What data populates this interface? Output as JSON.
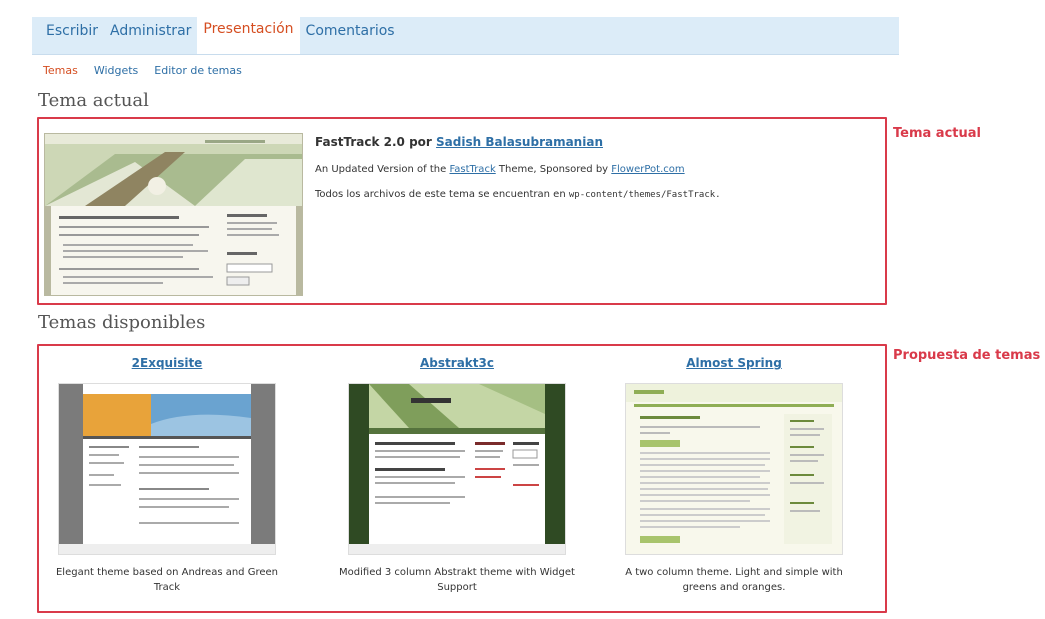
{
  "main_tabs": [
    {
      "label": "Escribir",
      "active": false
    },
    {
      "label": "Administrar",
      "active": false
    },
    {
      "label": "Presentación",
      "active": true
    },
    {
      "label": "Comentarios",
      "active": false
    }
  ],
  "sub_tabs": [
    {
      "label": "Temas",
      "active": true
    },
    {
      "label": "Widgets",
      "active": false
    },
    {
      "label": "Editor de temas",
      "active": false
    }
  ],
  "current_theme": {
    "heading": "Tema actual",
    "name": "FastTrack 2.0",
    "by": "por",
    "author": "Sadish Balasubramanian",
    "desc_prefix": "An Updated Version of the",
    "desc_link": "FastTrack",
    "desc_middle": "Theme, Sponsored by",
    "sponsor_link": "FlowerPot.com",
    "files_prefix": "Todos los archivos de este tema se encuentran en",
    "files_path": "wp-content/themes/FastTrack."
  },
  "available": {
    "heading": "Temas disponibles",
    "themes": [
      {
        "name": "2Exquisite",
        "description": "Elegant theme based on Andreas and Green Track"
      },
      {
        "name": "Abstrakt3c",
        "description": "Modified 3 column Abstrakt theme with Widget Support"
      },
      {
        "name": "Almost Spring",
        "description": "A two column theme. Light and simple with greens and oranges."
      }
    ]
  },
  "annotations": {
    "current_label": "Tema actual",
    "available_label": "Propuesta de temas"
  },
  "colors": {
    "link": "#2e6fa6",
    "active_tab": "#d54e21",
    "tab_bar": "#dcecf8",
    "annotation": "#d93a4a"
  }
}
